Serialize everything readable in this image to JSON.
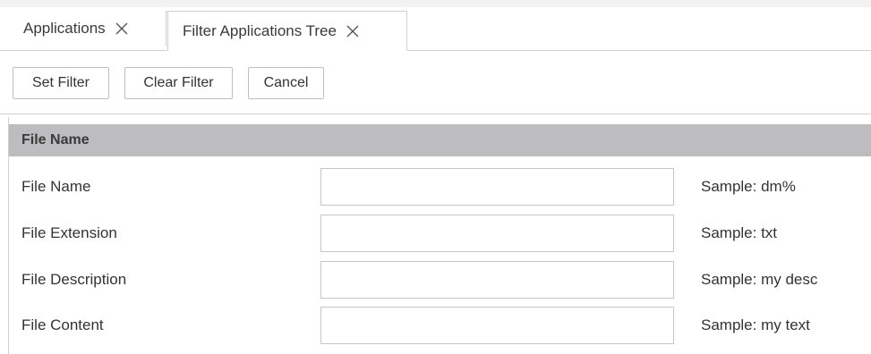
{
  "tabs": [
    {
      "label": "Applications",
      "close_icon": "close-icon"
    },
    {
      "label": "Filter Applications Tree",
      "close_icon": "close-icon",
      "active": true
    }
  ],
  "toolbar": {
    "set_filter_label": "Set Filter",
    "clear_filter_label": "Clear Filter",
    "cancel_label": "Cancel"
  },
  "section": {
    "title": "File Name"
  },
  "fields": [
    {
      "label": "File Name",
      "value": "",
      "sample": "Sample: dm%"
    },
    {
      "label": "File Extension",
      "value": "",
      "sample": "Sample: txt"
    },
    {
      "label": "File Description",
      "value": "",
      "sample": "Sample: my desc"
    },
    {
      "label": "File Content",
      "value": "",
      "sample": "Sample: my text"
    }
  ],
  "colors": {
    "section_header_bg": "#bdbdbf",
    "border": "#cfcfcf"
  }
}
